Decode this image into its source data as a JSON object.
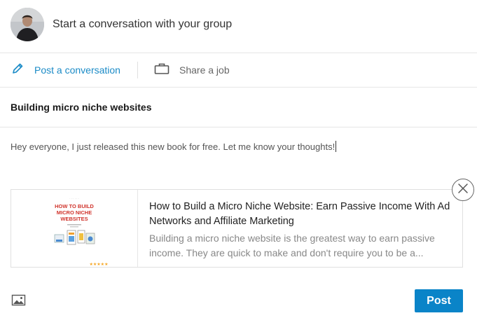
{
  "composer": {
    "prompt": "Start a conversation with your group",
    "actions": {
      "post_conversation": "Post a conversation",
      "share_job": "Share a job"
    },
    "group_title": "Building micro niche websites",
    "message": "Hey everyone, I just released this new book for free. Let me know your thoughts!"
  },
  "preview": {
    "title": "How to Build a Micro Niche Website: Earn Passive Income With Ad Networks and Affiliate Marketing",
    "description": "Building a micro niche website is the greatest way to earn passive income. They are quick to make and don't require you to be a...",
    "thumbnail": {
      "heading_line1": "HOW TO BUILD",
      "heading_line2": "MICRO NICHE",
      "heading_line3": "WEBSITES",
      "rating": "★★★★★"
    }
  },
  "footer": {
    "post_label": "Post"
  },
  "colors": {
    "accent": "#1b8bc7",
    "button": "#0a84c8",
    "book_title": "#d0342c"
  },
  "icons": {
    "post": "pencil-icon",
    "job": "briefcase-icon",
    "close": "close-icon",
    "photo": "image-icon"
  }
}
